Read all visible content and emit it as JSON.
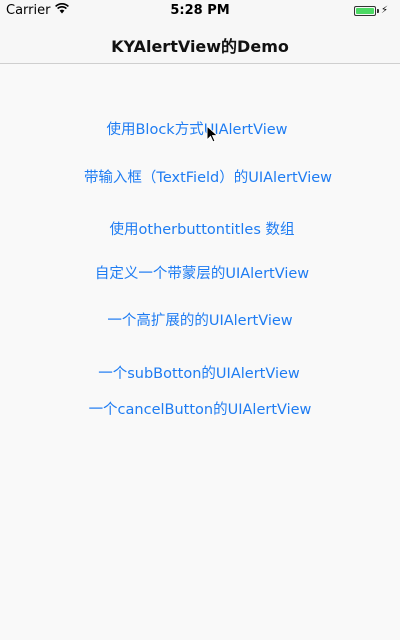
{
  "status_bar": {
    "carrier": "Carrier",
    "time": "5:28 PM",
    "battery_level": 1.0,
    "battery_color": "#4cd964"
  },
  "nav_bar": {
    "title": "KYAlertView的Demo"
  },
  "menu": {
    "items": [
      {
        "label": "使用Block方式UIAlertView"
      },
      {
        "label": "带输入框（TextField）的UIAlertView"
      },
      {
        "label": "使用otherbuttontitles 数组"
      },
      {
        "label": "自定义一个带蒙层的UIAlertView"
      },
      {
        "label": "一个高扩展的的UIAlertView"
      },
      {
        "label": "一个subBotton的UIAlertView"
      },
      {
        "label": "一个cancelButton的UIAlertView"
      }
    ]
  },
  "theme": {
    "link_color": "#1e7cf2",
    "background": "#f9f9f9"
  },
  "icons": [
    "wifi-icon",
    "battery-icon",
    "charging-icon",
    "mouse-pointer-icon"
  ]
}
